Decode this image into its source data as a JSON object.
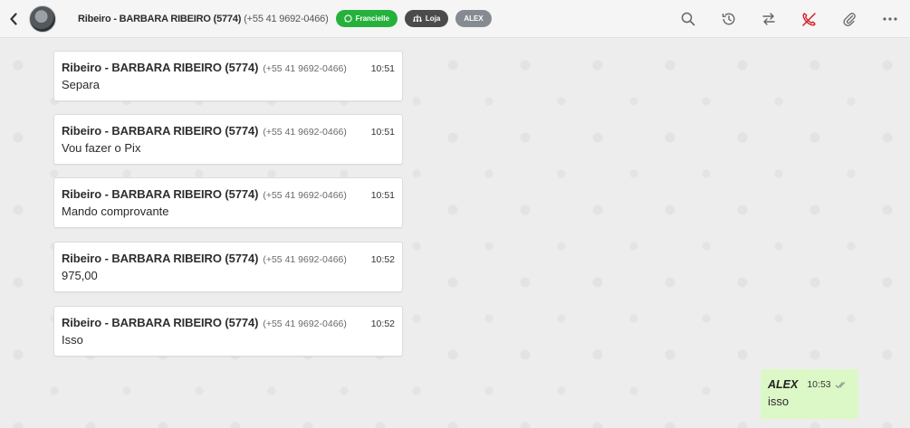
{
  "header": {
    "contact_name": "Ribeiro - BARBARA RIBEIRO (5774)",
    "contact_phone": "(+55 41 9692-0466)",
    "tags": [
      {
        "label": "Francielle",
        "icon": "whatsapp-icon",
        "color": "#25b13c"
      },
      {
        "label": "Loja",
        "icon": "sitemap-icon",
        "color": "#4b4b4b"
      },
      {
        "label": "ALEX",
        "icon": "",
        "color": "#858b90"
      }
    ],
    "actions": [
      "search-icon",
      "history-icon",
      "transfer-icon",
      "hangup-icon",
      "attach-icon",
      "more-icon"
    ]
  },
  "messages": [
    {
      "sender": "Ribeiro - BARBARA RIBEIRO (5774)",
      "phone": "(+55 41 9692-0466)",
      "time": "10:51",
      "text": "Separa"
    },
    {
      "sender": "Ribeiro - BARBARA RIBEIRO (5774)",
      "phone": "(+55 41 9692-0466)",
      "time": "10:51",
      "text": "Vou fazer o Pix"
    },
    {
      "sender": "Ribeiro - BARBARA RIBEIRO (5774)",
      "phone": "(+55 41 9692-0466)",
      "time": "10:51",
      "text": "Mando comprovante"
    },
    {
      "sender": "Ribeiro - BARBARA RIBEIRO (5774)",
      "phone": "(+55 41 9692-0466)",
      "time": "10:52",
      "text": "975,00"
    },
    {
      "sender": "Ribeiro - BARBARA RIBEIRO (5774)",
      "phone": "(+55 41 9692-0466)",
      "time": "10:52",
      "text": "Isso"
    }
  ],
  "outgoing": {
    "sender": "ALEX",
    "time": "10:53",
    "text": "isso",
    "status": "double-check-icon"
  },
  "colors": {
    "accent_green": "#25b13c",
    "hangup_red": "#d4202a",
    "outgoing_bubble": "#dcf8c6"
  }
}
